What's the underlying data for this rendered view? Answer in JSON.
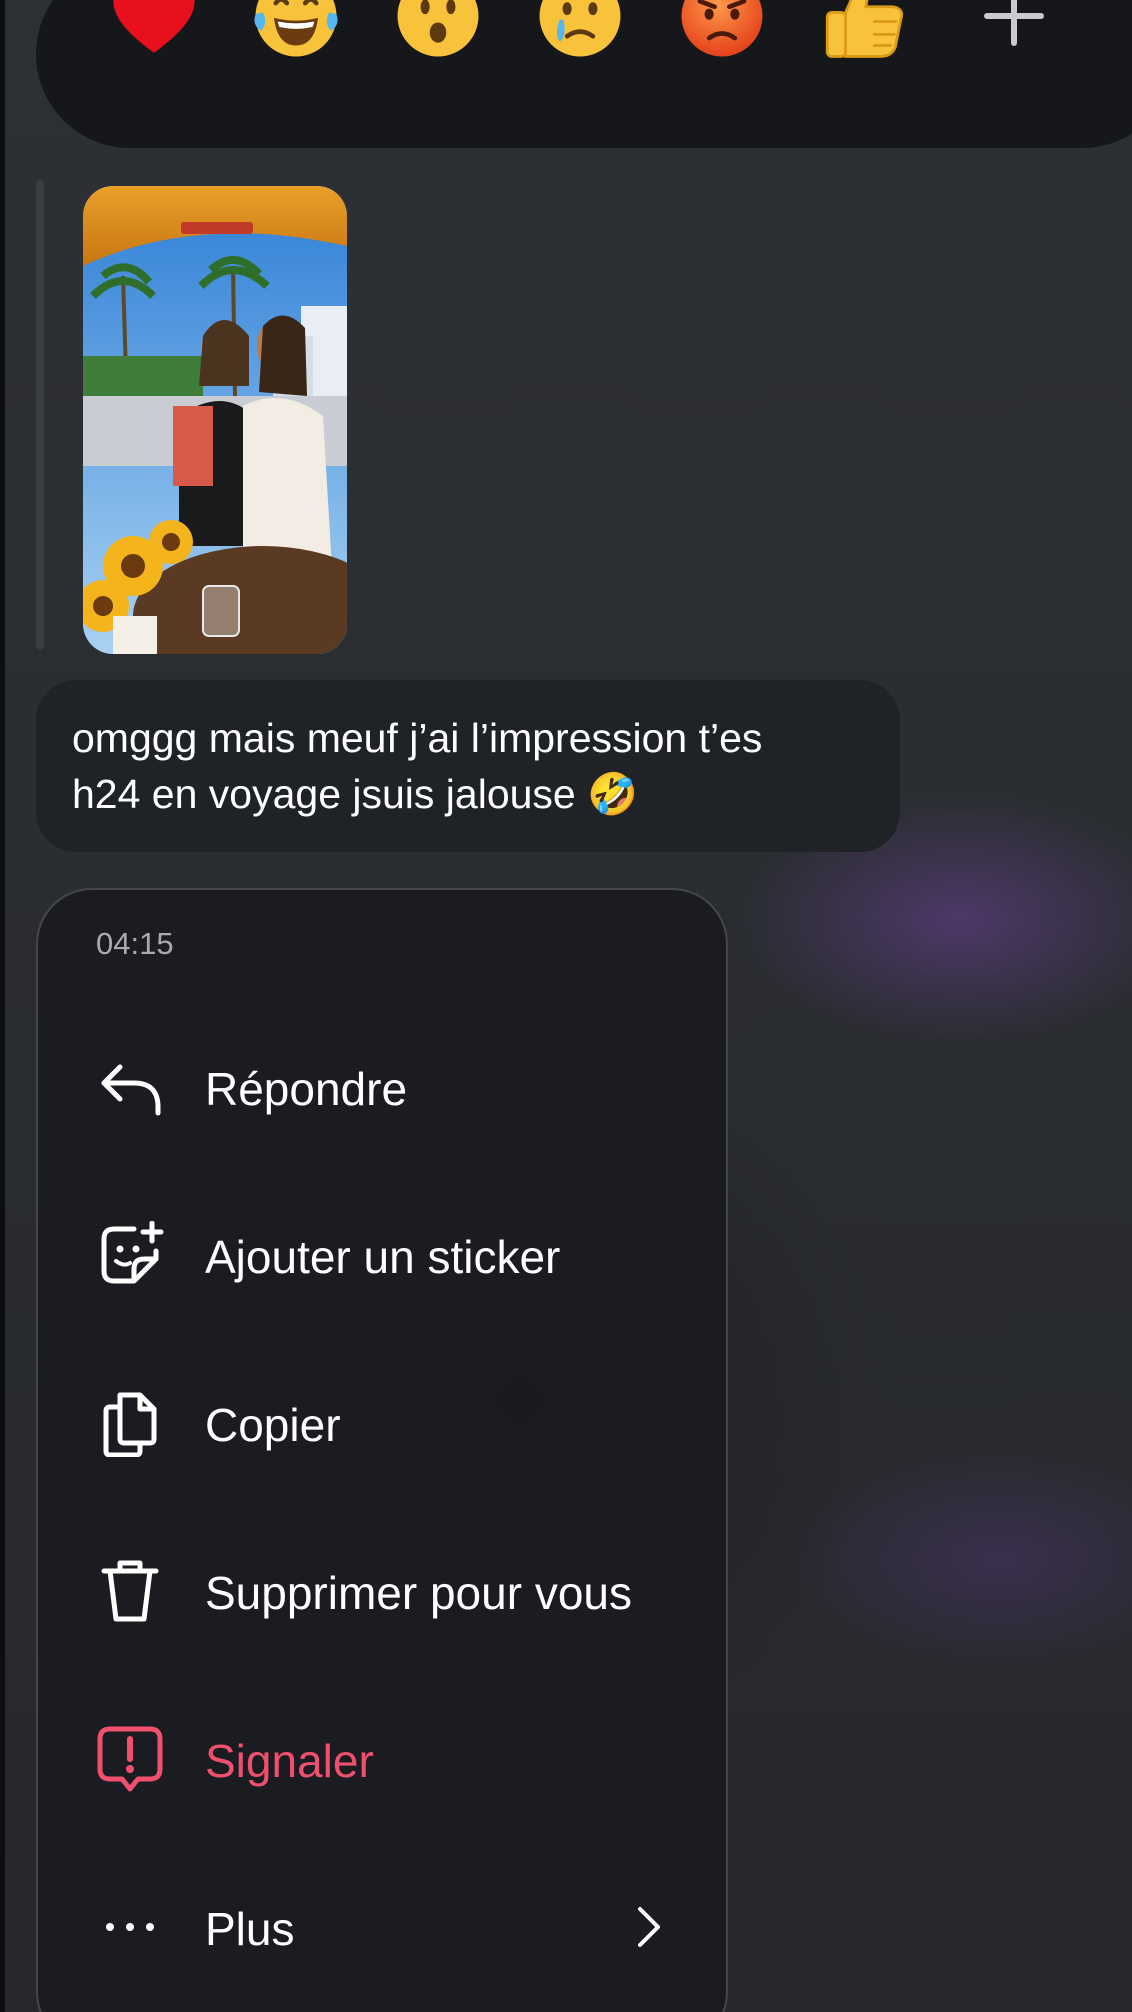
{
  "reactions": [
    {
      "name": "heart",
      "glyph": "❤️"
    },
    {
      "name": "laughing-crying",
      "glyph": "😂"
    },
    {
      "name": "surprised",
      "glyph": "😮"
    },
    {
      "name": "crying",
      "glyph": "😢"
    },
    {
      "name": "angry",
      "glyph": "😡"
    },
    {
      "name": "thumbs-up",
      "glyph": "👍"
    }
  ],
  "add_reaction_icon": "plus-icon",
  "message": {
    "text": "omggg mais meuf j’ai l’impression t’es\nh24 en voyage jsuis jalouse 🤣"
  },
  "menu": {
    "time": "04:15",
    "items": [
      {
        "label": "Répondre",
        "icon": "reply-icon"
      },
      {
        "label": "Ajouter un sticker",
        "icon": "add-sticker-icon"
      },
      {
        "label": "Copier",
        "icon": "copy-icon"
      },
      {
        "label": "Supprimer pour vous",
        "icon": "trash-icon"
      },
      {
        "label": "Signaler",
        "icon": "report-icon"
      },
      {
        "label": "Plus",
        "icon": "more-icon"
      }
    ]
  },
  "colors": {
    "danger": "#f0506e",
    "menu_bg": "#1b1c21",
    "bubble_bg": "#1f2226",
    "reaction_bar_bg": "#15171b"
  }
}
